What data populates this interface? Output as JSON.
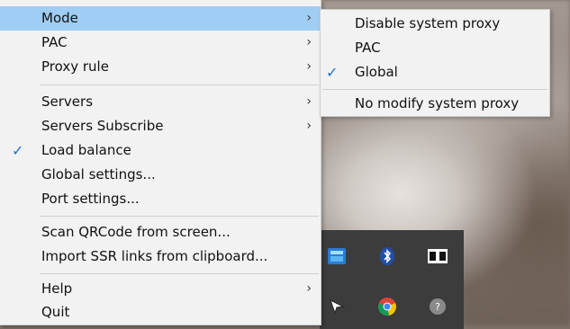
{
  "main_menu": {
    "items": [
      {
        "label": "Mode",
        "submenu": true
      },
      {
        "label": "PAC",
        "submenu": true
      },
      {
        "label": "Proxy rule",
        "submenu": true
      },
      {
        "label": "Servers",
        "submenu": true
      },
      {
        "label": "Servers Subscribe",
        "submenu": true
      },
      {
        "label": "Load balance",
        "checked": true
      },
      {
        "label": "Global settings..."
      },
      {
        "label": "Port settings..."
      },
      {
        "label": "Scan QRCode from screen..."
      },
      {
        "label": "Import SSR links from clipboard..."
      },
      {
        "label": "Help",
        "submenu": true
      },
      {
        "label": "Quit"
      }
    ]
  },
  "mode_submenu": {
    "items": [
      {
        "label": "Disable system proxy"
      },
      {
        "label": "PAC"
      },
      {
        "label": "Global",
        "checked": true
      },
      {
        "label": "No modify system proxy"
      }
    ]
  },
  "glyphs": {
    "arrow": "›",
    "check": "✓"
  },
  "colors": {
    "highlight": "#9fcdf3",
    "check": "#1f6fd1",
    "menu_bg": "#f2f2f2"
  },
  "tray_icons": [
    "shadowsocksr-icon",
    "bluetooth-icon",
    "dolby-icon",
    "cursor-icon",
    "chrome-icon",
    "help-icon"
  ]
}
